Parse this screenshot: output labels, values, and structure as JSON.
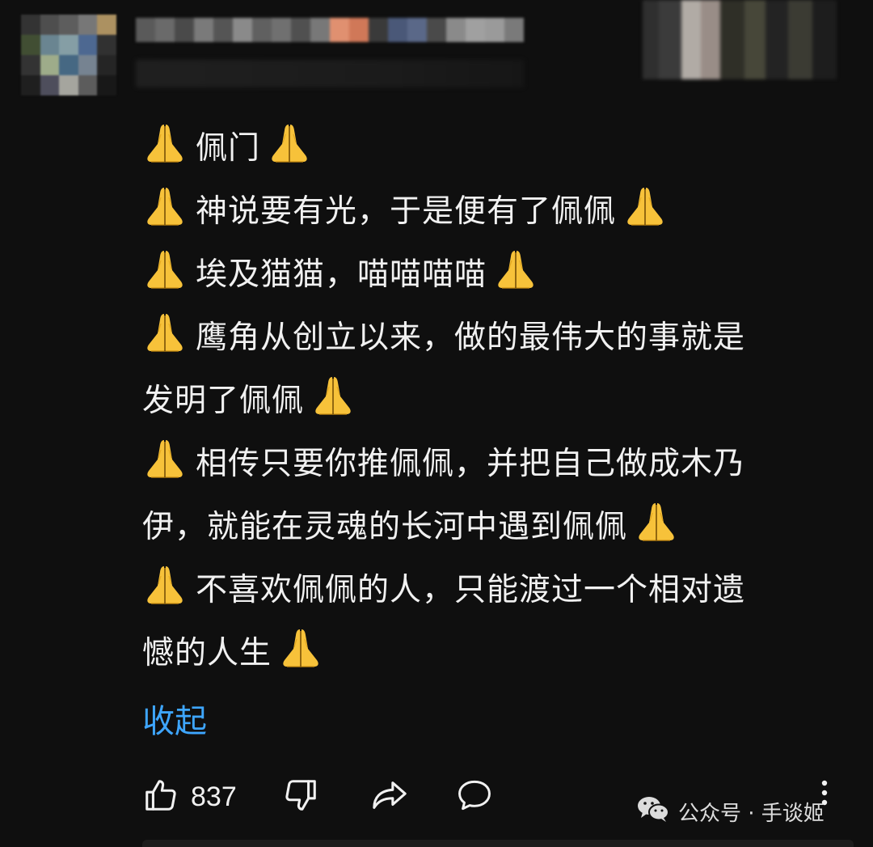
{
  "comment": {
    "lines": [
      {
        "text": "佩门",
        "emoji_before": true,
        "emoji_after": true
      },
      {
        "text": "神说要有光，于是便有了佩佩",
        "emoji_before": true,
        "emoji_after": true
      },
      {
        "text": "埃及猫猫，喵喵喵喵",
        "emoji_before": true,
        "emoji_after": true
      },
      {
        "text": "鹰角从创立以来，做的最伟大的事就是",
        "emoji_before": true,
        "emoji_after": false
      },
      {
        "text": "发明了佩佩",
        "emoji_before": false,
        "emoji_after": true
      },
      {
        "text": "相传只要你推佩佩，并把自己做成木乃",
        "emoji_before": true,
        "emoji_after": false
      },
      {
        "text": "伊，就能在灵魂的长河中遇到佩佩",
        "emoji_before": false,
        "emoji_after": true
      },
      {
        "text": "不喜欢佩佩的人，只能渡过一个相对遗",
        "emoji_before": true,
        "emoji_after": false
      },
      {
        "text": "憾的人生",
        "emoji_before": false,
        "emoji_after": true
      }
    ],
    "emoji_icon": "folded-hands-icon",
    "collapse_label": "收起"
  },
  "actions": {
    "like_count": "837",
    "like_icon": "thumbs-up-icon",
    "dislike_icon": "thumbs-down-icon",
    "share_icon": "share-icon",
    "reply_icon": "reply-bubble-icon",
    "more_icon": "more-vertical-icon"
  },
  "watermark": {
    "text": "公众号 · 手谈姬",
    "icon": "wechat-icon"
  },
  "colors": {
    "background": "#0f0f0f",
    "text": "#f1f1f1",
    "link": "#3ea6ff",
    "emoji": "#f7c23a"
  }
}
